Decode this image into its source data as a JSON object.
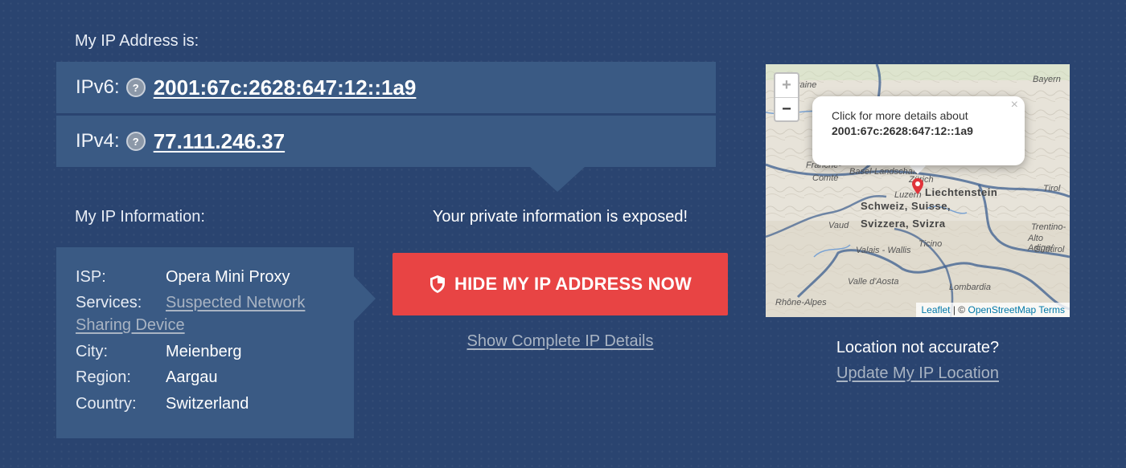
{
  "ip_section": {
    "heading": "My IP Address is:",
    "ipv6": {
      "label": "IPv6:",
      "help": "?",
      "value": "2001:67c:2628:647:12::1a9"
    },
    "ipv4": {
      "label": "IPv4:",
      "help": "?",
      "value": "77.111.246.37"
    }
  },
  "info_section": {
    "heading": "My IP Information:",
    "rows": [
      {
        "key": "ISP:",
        "value": "Opera Mini Proxy"
      },
      {
        "key": "Services:",
        "value_line1": "Suspected Network",
        "value_line2": "Sharing Device"
      },
      {
        "key": "City:",
        "value": "Meienberg"
      },
      {
        "key": "Region:",
        "value": "Aargau"
      },
      {
        "key": "Country:",
        "value": "Switzerland"
      }
    ]
  },
  "exposure": {
    "warning": "Your private information is exposed!",
    "button_label": "HIDE MY IP ADDRESS NOW",
    "button_icon": "shield-icon",
    "details_link": "Show Complete IP Details"
  },
  "map": {
    "zoom_in": "+",
    "zoom_out": "−",
    "popup": {
      "text": "Click for more details about",
      "ip": "2001:67c:2628:647:12::1a9",
      "close": "×"
    },
    "labels": {
      "lorraine": "Lorraine",
      "bayern": "Bayern",
      "franche": "Franche-",
      "comte": "Comté",
      "basel": "Basel-Landschaft",
      "zurich": "Zürich",
      "luzern": "Luzern",
      "liechtenstein": "Liechtenstein",
      "schweiz": "Schweiz, Suisse,",
      "svizzera": "Svizzera, Svizra",
      "tirol": "Tirol",
      "vaud": "Vaud",
      "ticino": "Ticino",
      "trentino": "Trentino-",
      "alto_adige": "Alto Adige/",
      "sudtirol": "Südtirol",
      "valais": "Valais - Wallis",
      "aosta": "Valle d'Aosta",
      "lombardia": "Lombardia",
      "rhone": "Rhône-Alpes"
    },
    "attribution": {
      "leaflet": "Leaflet",
      "separator": " | © ",
      "osm": "OpenStreetMap",
      "terms": "Terms"
    },
    "colors": {
      "border": "#3b5d8f",
      "marker": "#e0333a"
    }
  },
  "location": {
    "question": "Location not accurate?",
    "update_link": "Update My IP Location"
  }
}
